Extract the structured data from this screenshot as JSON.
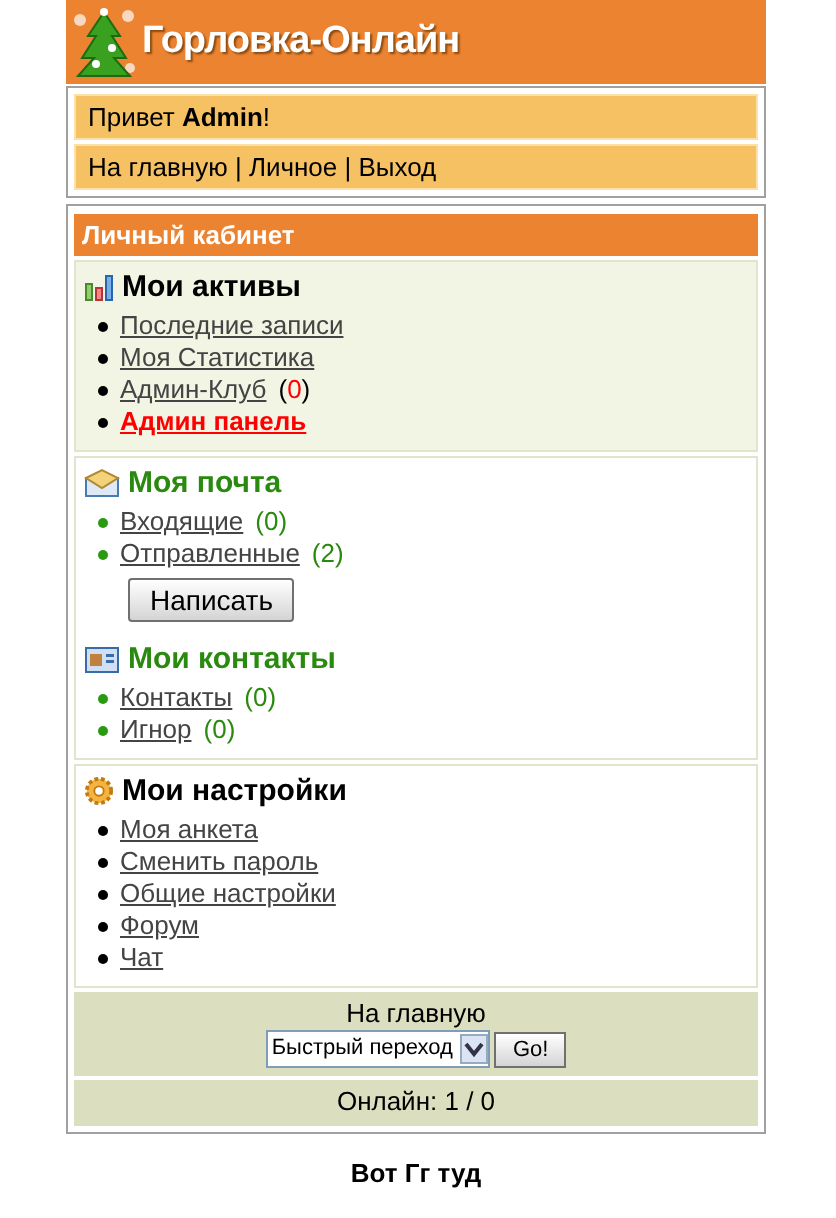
{
  "header": {
    "title": "Горловка-Онлайн"
  },
  "greeting": "Привет **Admin**!",
  "nav": "На главную | Личное | Выход",
  "cabinet": {
    "title": "Личный кабинет",
    "panels": [
      {
        "groups": [
          {
            "title": "Мои активы",
            "items": [
              {
                "label": "Последние записи",
                "kind": "link"
              },
              {
                "label": "Моя Статистика",
                "kind": "link"
              },
              {
                "label": "Админ-Клуб",
                "kind": "link",
                "count": {
                  "open": "(",
                  "value": "0",
                  "close": ")",
                  "alert": true
                }
              },
              {
                "label": "Админ панель",
                "kind": "admin"
              }
            ]
          }
        ]
      },
      {
        "groups": [
          {
            "title": "Моя почта",
            "items": [
              {
                "label": "Входящие",
                "kind": "link",
                "count": {
                  "open": "(",
                  "value": "0",
                  "close": ")",
                  "alert": false
                }
              },
              {
                "label": "Отправленные",
                "kind": "link",
                "count": {
                  "open": "(",
                  "value": "2",
                  "close": ")",
                  "alert": false
                }
              }
            ],
            "button": "Написать"
          },
          {
            "title": "Мои контакты",
            "items": [
              {
                "label": "Контакты",
                "kind": "link",
                "count": {
                  "open": "(",
                  "value": "0",
                  "close": ")",
                  "alert": false
                }
              },
              {
                "label": "Игнор",
                "kind": "link",
                "count": {
                  "open": "(",
                  "value": "0",
                  "close": ")",
                  "alert": false
                }
              }
            ]
          }
        ]
      },
      {
        "groups": [
          {
            "title": "Мои настройки",
            "items": [
              {
                "label": "Моя анкета",
                "kind": "link"
              },
              {
                "label": "Сменить пароль",
                "kind": "link"
              },
              {
                "label": "Общие настройки",
                "kind": "link"
              },
              {
                "label": "Форум",
                "kind": "link"
              },
              {
                "label": "Чат",
                "kind": "link"
              }
            ]
          }
        ]
      }
    ]
  },
  "footer": {
    "home_link": "На главную",
    "quick_jump": "Быстрый переход",
    "go_button": "Go!",
    "online": "Онлайн: 1 / 0"
  },
  "bottom_text": "Вот Гг туд"
}
